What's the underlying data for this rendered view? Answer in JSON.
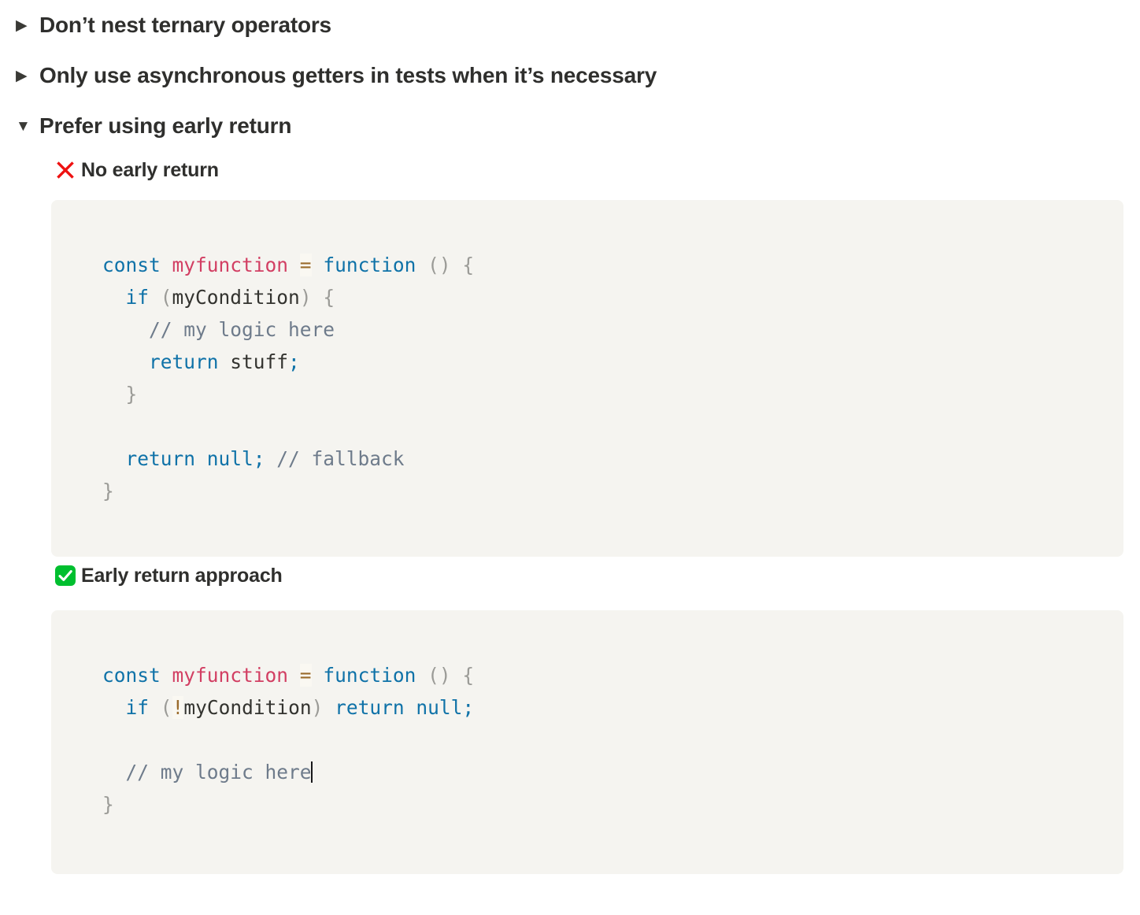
{
  "rules": [
    {
      "marker_icon": "triangle-right-icon",
      "marker_glyph": "▶",
      "title": "Don’t nest ternary operators",
      "expanded": false
    },
    {
      "marker_icon": "triangle-right-icon",
      "marker_glyph": "▶",
      "title": "Only use asynchronous getters in tests when it’s necessary",
      "expanded": false
    },
    {
      "marker_icon": "triangle-down-icon",
      "marker_glyph": "▼",
      "title": "Prefer using early return",
      "expanded": true
    }
  ],
  "examples": {
    "bad": {
      "badge_icon": "cross-mark-icon",
      "badge_color": "#ee1111",
      "heading": "No early return",
      "code_lines": [
        [
          {
            "text": "const ",
            "cls": "t-kw"
          },
          {
            "text": "myfunction ",
            "cls": "t-fn"
          },
          {
            "text": "=",
            "cls": "t-op"
          },
          {
            "text": " ",
            "cls": "t-id"
          },
          {
            "text": "function",
            "cls": "t-kw"
          },
          {
            "text": " () {",
            "cls": "t-punc"
          }
        ],
        [
          {
            "text": "  ",
            "cls": "t-id"
          },
          {
            "text": "if",
            "cls": "t-kw"
          },
          {
            "text": " (",
            "cls": "t-punc"
          },
          {
            "text": "myCondition",
            "cls": "t-id"
          },
          {
            "text": ") {",
            "cls": "t-punc"
          }
        ],
        [
          {
            "text": "    ",
            "cls": "t-id"
          },
          {
            "text": "// my logic here",
            "cls": "t-cmt"
          }
        ],
        [
          {
            "text": "    ",
            "cls": "t-id"
          },
          {
            "text": "return",
            "cls": "t-kw"
          },
          {
            "text": " stuff",
            "cls": "t-id"
          },
          {
            "text": ";",
            "cls": "t-semi"
          }
        ],
        [
          {
            "text": "  }",
            "cls": "t-punc"
          }
        ],
        [
          {
            "text": "",
            "cls": "t-id"
          }
        ],
        [
          {
            "text": "  ",
            "cls": "t-id"
          },
          {
            "text": "return null",
            "cls": "t-kw"
          },
          {
            "text": ";",
            "cls": "t-semi"
          },
          {
            "text": " // fallback",
            "cls": "t-cmt"
          }
        ],
        [
          {
            "text": "}",
            "cls": "t-punc"
          }
        ]
      ]
    },
    "good": {
      "badge_icon": "check-mark-button-icon",
      "badge_color": "#00bf2f",
      "heading": "Early return approach",
      "code_lines": [
        [
          {
            "text": "const ",
            "cls": "t-kw"
          },
          {
            "text": "myfunction ",
            "cls": "t-fn"
          },
          {
            "text": "=",
            "cls": "t-op"
          },
          {
            "text": " ",
            "cls": "t-id"
          },
          {
            "text": "function",
            "cls": "t-kw"
          },
          {
            "text": " () {",
            "cls": "t-punc"
          }
        ],
        [
          {
            "text": "  ",
            "cls": "t-id"
          },
          {
            "text": "if",
            "cls": "t-kw"
          },
          {
            "text": " (",
            "cls": "t-punc"
          },
          {
            "text": "!",
            "cls": "t-op"
          },
          {
            "text": "myCondition",
            "cls": "t-id"
          },
          {
            "text": ")",
            "cls": "t-punc"
          },
          {
            "text": " return null",
            "cls": "t-kw"
          },
          {
            "text": ";",
            "cls": "t-semi"
          }
        ],
        [
          {
            "text": "",
            "cls": "t-id"
          }
        ],
        [
          {
            "text": "  ",
            "cls": "t-id"
          },
          {
            "text": "// my logic here",
            "cls": "t-cmt",
            "caret": true
          }
        ],
        [
          {
            "text": "}",
            "cls": "t-punc"
          }
        ]
      ]
    }
  },
  "theme": {
    "page_background": "#ffffff",
    "code_background": "#f5f4f0",
    "keyword_color": "#0f72a8",
    "function_color": "#d23f63",
    "operator_color": "#9a6b2c",
    "punctuation_color": "#9b9b97",
    "comment_color": "#6e7b8b",
    "text_color": "#2f2f2d"
  }
}
